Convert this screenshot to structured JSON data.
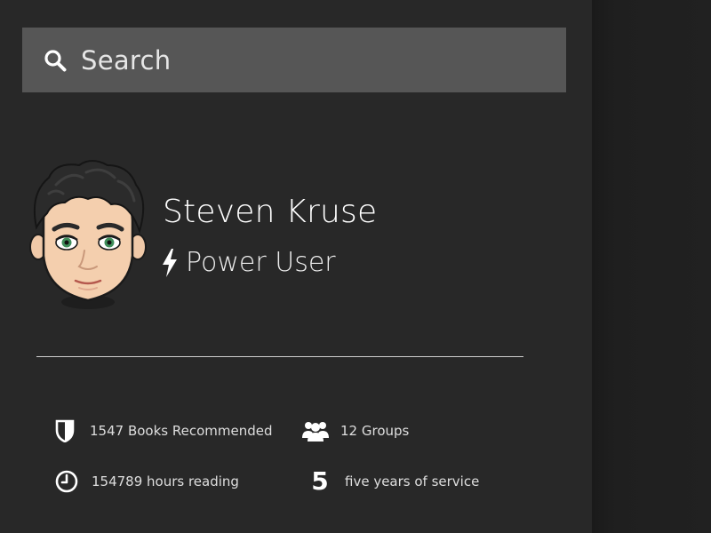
{
  "search": {
    "placeholder": "Search",
    "icon": "search-icon"
  },
  "profile": {
    "name": "Steven Kruse",
    "role": "Power User",
    "role_icon": "lightning-bolt-icon",
    "avatar": "cartoon-avatar"
  },
  "stats": {
    "books": {
      "icon": "shield-icon",
      "label": "1547 Books Recommended"
    },
    "groups": {
      "icon": "users-group-icon",
      "label": "12 Groups"
    },
    "hours": {
      "icon": "clock-icon",
      "label": "154789 hours  reading"
    },
    "years": {
      "number": "5",
      "label": "five years of service"
    }
  },
  "colors": {
    "panel_bg": "#282828",
    "search_bg": "#565656",
    "page_bg": "#1c1c1c",
    "text": "#ffffff"
  }
}
